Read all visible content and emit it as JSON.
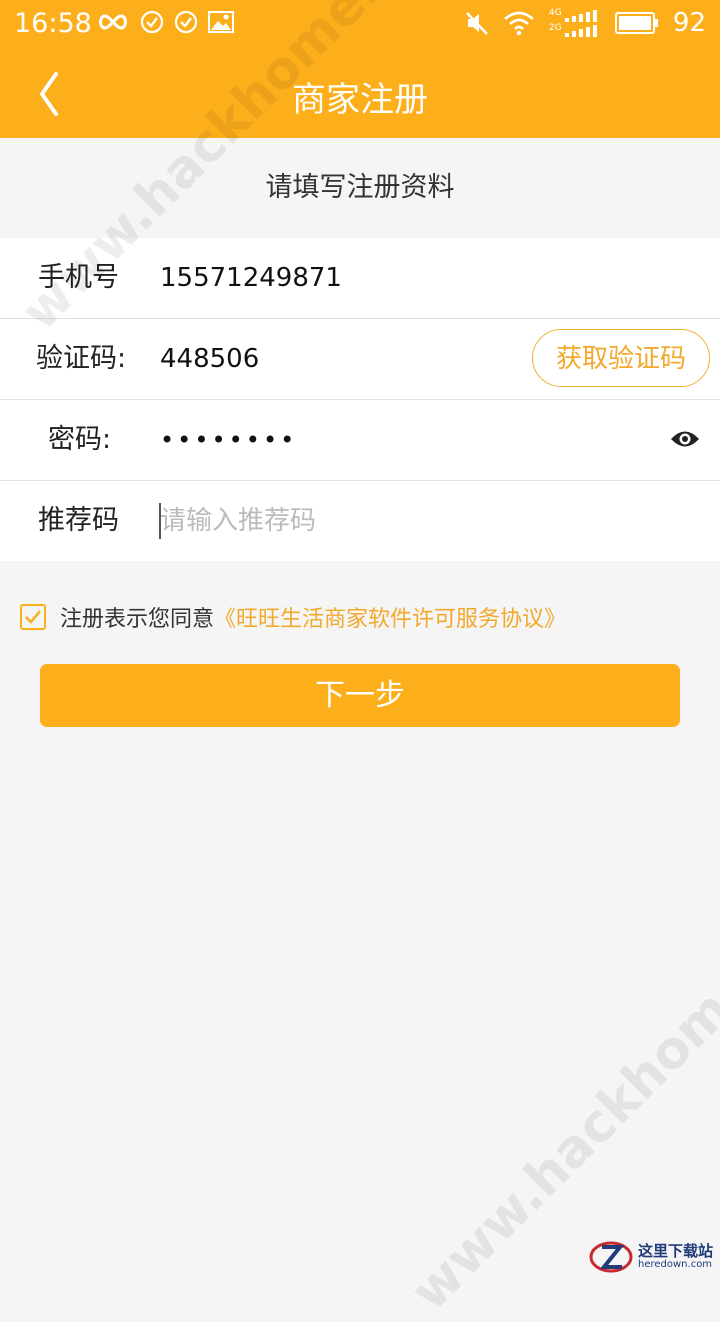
{
  "status_bar": {
    "time": "16:58",
    "battery": "92",
    "network_labels": [
      "4G",
      "2G"
    ],
    "left_icons": [
      "infinity-icon",
      "check-circle-icon",
      "check-circle-icon",
      "image-icon"
    ],
    "right_icons": [
      "mute-icon",
      "wifi-icon",
      "signal-icon",
      "battery-icon"
    ]
  },
  "app_bar": {
    "title": "商家注册",
    "back_icon": "chevron-left-icon",
    "background": "#fdae1b"
  },
  "subtitle": "请填写注册资料",
  "form": {
    "phone": {
      "label": "手机号",
      "value": "15571249871"
    },
    "code": {
      "label": "验证码:",
      "value": "448506",
      "button": "获取验证码"
    },
    "password": {
      "label": "密码:",
      "value": "••••••••",
      "toggle_icon": "eye-icon"
    },
    "referral": {
      "label": "推荐码",
      "placeholder": "请输入推荐码"
    }
  },
  "agreement": {
    "checked": true,
    "text": "注册表示您同意",
    "link": "《旺旺生活商家软件许可服务协议》"
  },
  "next_button": "下一步",
  "watermarks": {
    "top": "www.hackhome.com",
    "bottom": "www.hackhome.com",
    "corner_cn": "这里下载站",
    "corner_en": "heredown.com"
  },
  "colors": {
    "accent": "#fdae1b",
    "link": "#f2a92b",
    "background": "#f5f5f5"
  }
}
